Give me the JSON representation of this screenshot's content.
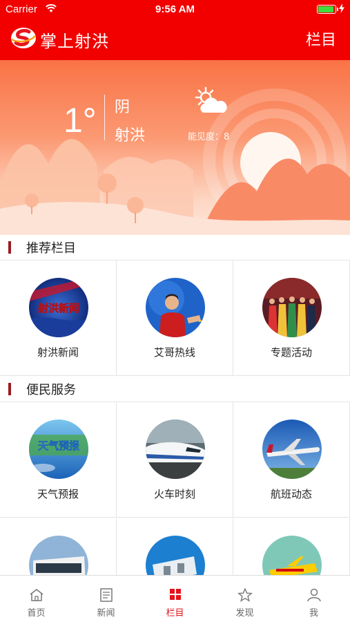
{
  "status_bar": {
    "carrier": "Carrier",
    "time": "9:56 AM",
    "battery_level": 0.95
  },
  "header": {
    "title": "掌上射洪",
    "right_link": "栏目"
  },
  "weather": {
    "temperature": "1°",
    "condition": "阴",
    "city": "射洪",
    "visibility": "能见度：8",
    "icon": "partly-cloudy-icon"
  },
  "sections": [
    {
      "title": "推荐栏目",
      "items": [
        {
          "label": "射洪新闻",
          "thumb_text": "射洪新闻"
        },
        {
          "label": "艾哥热线"
        },
        {
          "label": "专题活动"
        }
      ]
    },
    {
      "title": "便民服务",
      "items": [
        {
          "label": "天气预报",
          "thumb_text": "天气预报"
        },
        {
          "label": "火车时刻"
        },
        {
          "label": "航班动态"
        },
        {
          "label": ""
        },
        {
          "label": ""
        },
        {
          "label": ""
        }
      ]
    }
  ],
  "tabs": [
    {
      "label": "首页",
      "icon": "home-icon"
    },
    {
      "label": "新闻",
      "icon": "news-icon"
    },
    {
      "label": "栏目",
      "icon": "grid-icon",
      "active": true
    },
    {
      "label": "发现",
      "icon": "star-icon"
    },
    {
      "label": "我",
      "icon": "user-icon"
    }
  ],
  "colors": {
    "brand_red": "#f20000",
    "section_bar": "#9a1b22",
    "active_tab": "#e4141b"
  }
}
